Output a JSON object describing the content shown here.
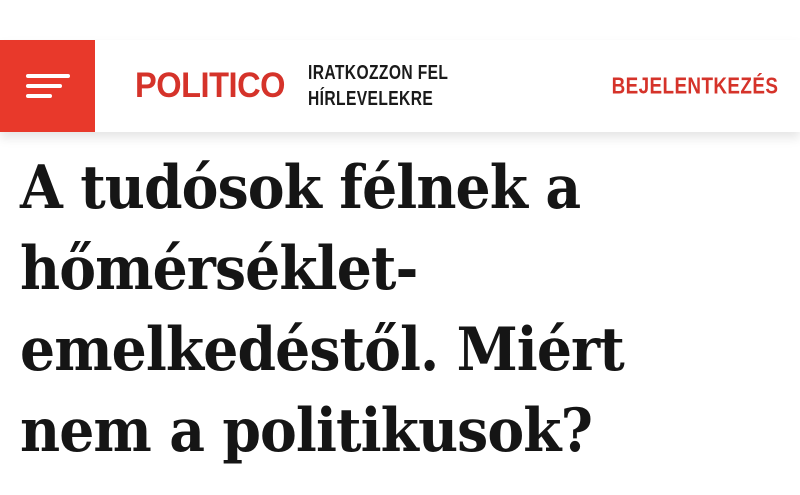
{
  "header": {
    "menu_icon": "hamburger-menu-icon",
    "logo_text": "POLITICO",
    "newsletter_line1": "IRATKOZZON FEL",
    "newsletter_line2": "HÍRLEVELEKRE",
    "login_label": "BEJELENTKEZÉS"
  },
  "article": {
    "headline_lines": [
      "A tudósok félnek a",
      "hőmérséklet-",
      "emelkedéstől. Miért",
      "nem a politikusok?"
    ]
  },
  "colors": {
    "brand_red": "#d5332a",
    "menu_red": "#e8392b",
    "headline_text": "#151515"
  }
}
